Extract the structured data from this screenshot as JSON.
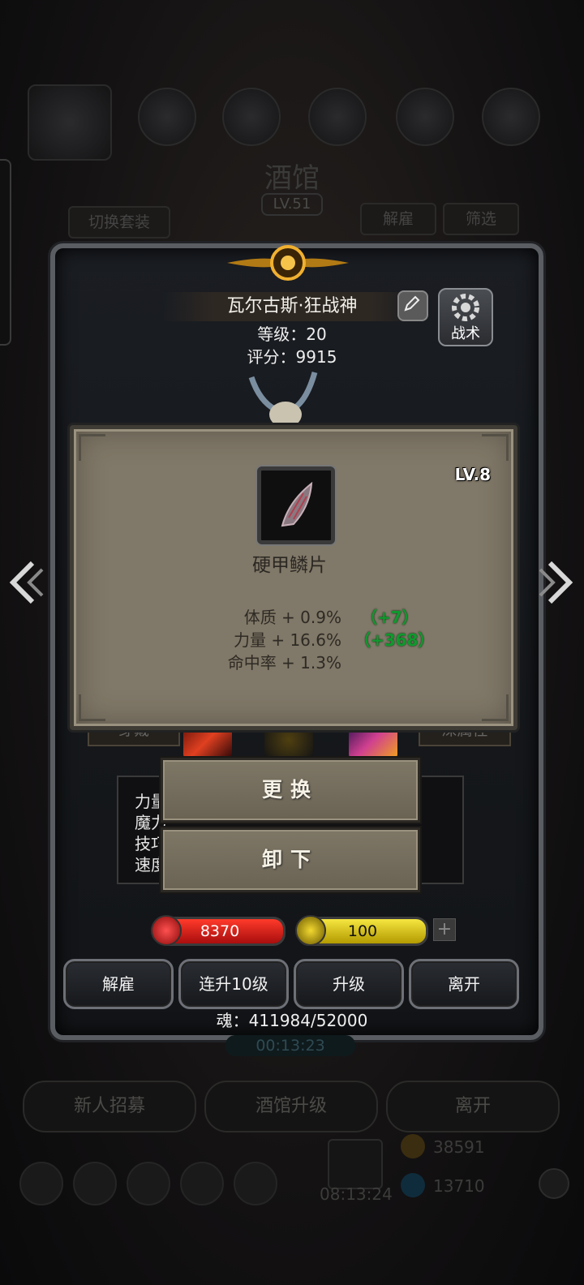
{
  "background": {
    "title": "酒馆",
    "level": "LV.51",
    "switch_outfit": "切换套装",
    "dismiss": "解雇",
    "filter": "筛选",
    "bottom_buttons": [
      "新人招募",
      "酒馆升级",
      "离开"
    ],
    "currency_gold": "38591",
    "currency_gem": "13710",
    "gift_timer": "08:13:24"
  },
  "hero": {
    "name": "瓦尔古斯·狂战神",
    "level_text": "等级：20",
    "score_text": "评分：9915",
    "tactics_label": "战术",
    "equip_tab": "穿戴",
    "attr_tab": "深属性",
    "stats_labels": [
      "力量",
      "魔力",
      "技巧",
      "速度"
    ]
  },
  "item_popup": {
    "level": "LV.8",
    "name": "硬甲鳞片",
    "stats": [
      {
        "main": "体质 + 0.9%",
        "bonus": "（+7）"
      },
      {
        "main": "力量 + 16.6%",
        "bonus": "（+368）"
      },
      {
        "main": "命中率 + 1.3%",
        "bonus": ""
      }
    ]
  },
  "action_menu": {
    "replace": "更换",
    "unequip": "卸下"
  },
  "bars": {
    "hp": "8370",
    "energy": "100",
    "plus": "+",
    "hp_color": "#d01818",
    "energy_color": "#d6c40a"
  },
  "hero_actions": [
    "解雇",
    "连升10级",
    "升级",
    "离开"
  ],
  "soul_text": "魂：411984/52000",
  "timer": "00:13:23"
}
